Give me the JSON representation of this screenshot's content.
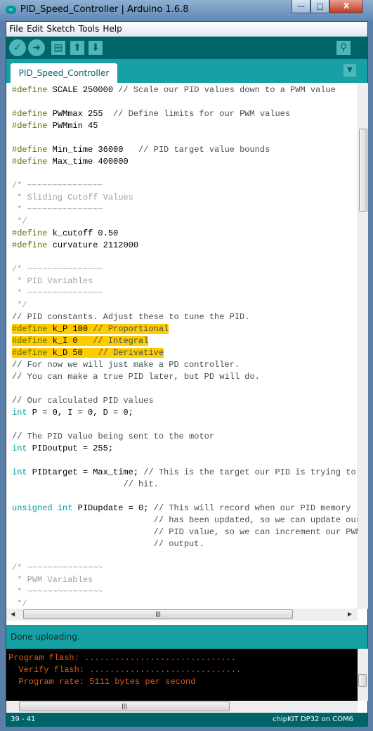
{
  "window": {
    "title": "PID_Speed_Controller | Arduino 1.6.8",
    "minimize": "—",
    "maximize": "□",
    "close": "X"
  },
  "menu": [
    "File",
    "Edit",
    "Sketch",
    "Tools",
    "Help"
  ],
  "toolbar": {
    "verify": "✓",
    "upload": "➜",
    "new": "▤",
    "open": "⬆",
    "save": "⬇",
    "serial_monitor": "⚲"
  },
  "tab": {
    "label": "PID_Speed_Controller",
    "menu": "▼"
  },
  "colors": {
    "accent": "#17a1a5",
    "dark": "#006468",
    "highlight": "#ffcc00"
  },
  "code": [
    [
      [
        "kw",
        "#define"
      ],
      [
        "tx",
        " SCALE 250000 "
      ],
      [
        "cm",
        "// Scale our PID values down to a PWM value"
      ]
    ],
    [],
    [
      [
        "kw",
        "#define"
      ],
      [
        "tx",
        " PWMmax 255  "
      ],
      [
        "cm",
        "// Define limits for our PWM values"
      ]
    ],
    [
      [
        "kw",
        "#define"
      ],
      [
        "tx",
        " PWMmin 45"
      ]
    ],
    [],
    [
      [
        "kw",
        "#define"
      ],
      [
        "tx",
        " Min_time 36000   "
      ],
      [
        "cm",
        "// PID target value bounds"
      ]
    ],
    [
      [
        "kw",
        "#define"
      ],
      [
        "tx",
        " Max_time 400000"
      ]
    ],
    [],
    [
      [
        "bc",
        "/* ~~~~~~~~~~~~~~~"
      ]
    ],
    [
      [
        "bc",
        " * Sliding Cutoff Values"
      ]
    ],
    [
      [
        "bc",
        " * ~~~~~~~~~~~~~~~"
      ]
    ],
    [
      [
        "bc",
        " */"
      ]
    ],
    [
      [
        "kw",
        "#define"
      ],
      [
        "tx",
        " k_cutoff 0.50"
      ]
    ],
    [
      [
        "kw",
        "#define"
      ],
      [
        "tx",
        " curvature 2112000"
      ]
    ],
    [],
    [
      [
        "bc",
        "/* ~~~~~~~~~~~~~~~"
      ]
    ],
    [
      [
        "bc",
        " * PID Variables"
      ]
    ],
    [
      [
        "bc",
        " * ~~~~~~~~~~~~~~~"
      ]
    ],
    [
      [
        "bc",
        " */"
      ]
    ],
    [
      [
        "cm",
        "// PID constants. Adjust these to tune the PID."
      ]
    ],
    [
      [
        "kw",
        "#define"
      ],
      [
        "tx",
        " k_P 100 "
      ],
      [
        "cm",
        "// Proportional"
      ]
    ],
    [
      [
        "kw",
        "#define"
      ],
      [
        "tx",
        " k_I 0   "
      ],
      [
        "cm",
        "// Integral"
      ]
    ],
    [
      [
        "kw",
        "#define"
      ],
      [
        "tx",
        " k_D 50   "
      ],
      [
        "cm",
        "// Derivative"
      ]
    ],
    [
      [
        "cm",
        "// For now we will just make a PD controller."
      ]
    ],
    [
      [
        "cm",
        "// You can make a true PID later, but PD will do."
      ]
    ],
    [],
    [
      [
        "cm",
        "// Our calculated PID values"
      ]
    ],
    [
      [
        "ty",
        "int"
      ],
      [
        "tx",
        " P = 0, I = 0, D = 0;"
      ]
    ],
    [],
    [
      [
        "cm",
        "// The PID value being sent to the motor"
      ]
    ],
    [
      [
        "ty",
        "int"
      ],
      [
        "tx",
        " PIDoutput = 255;"
      ]
    ],
    [],
    [
      [
        "ty",
        "int"
      ],
      [
        "tx",
        " PIDtarget = Max_time; "
      ],
      [
        "cm",
        "// This is the target our PID is trying to"
      ]
    ],
    [
      [
        "tx",
        "                      "
      ],
      [
        "cm",
        "// hit."
      ]
    ],
    [],
    [
      [
        "ty",
        "unsigned"
      ],
      [
        "tx",
        " "
      ],
      [
        "ty",
        "int"
      ],
      [
        "tx",
        " PIDupdate = 0; "
      ],
      [
        "cm",
        "// This will record when our PID memory"
      ]
    ],
    [
      [
        "tx",
        "                            "
      ],
      [
        "cm",
        "// has been updated, so we can update our"
      ]
    ],
    [
      [
        "tx",
        "                            "
      ],
      [
        "cm",
        "// PID value, so we can increment our PWM"
      ]
    ],
    [
      [
        "tx",
        "                            "
      ],
      [
        "cm",
        "// output."
      ]
    ],
    [],
    [
      [
        "bc",
        "/* ~~~~~~~~~~~~~~~"
      ]
    ],
    [
      [
        "bc",
        " * PWM Variables"
      ]
    ],
    [
      [
        "bc",
        " * ~~~~~~~~~~~~~~~"
      ]
    ],
    [
      [
        "bc",
        " */"
      ]
    ]
  ],
  "highlighted_lines": [
    20,
    21,
    22
  ],
  "status": {
    "message": "Done uploading."
  },
  "console": [
    "Program flash: ..............................",
    "  Verify flash: ..............................",
    "  Program rate: 5111 bytes per second"
  ],
  "footer": {
    "position": "39 - 41",
    "board": "chipKIT DP32 on COM6"
  }
}
